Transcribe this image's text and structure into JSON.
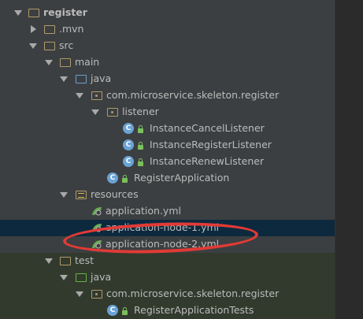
{
  "tree": {
    "root": "register",
    "mvn": ".mvn",
    "src": "src",
    "main": "main",
    "java": "java",
    "main_package": "com.microservice.skeleton.register",
    "listener": "listener",
    "listener_classes": [
      "InstanceCancelListener",
      "InstanceRegisterListener",
      "InstanceRenewListener"
    ],
    "register_app": "RegisterApplication",
    "resources": "resources",
    "yml_files": [
      "application.yml",
      "application-node-1.yml",
      "application-node-2.yml"
    ],
    "test": "test",
    "test_java": "java",
    "test_package": "com.microservice.skeleton.register",
    "test_class": "RegisterApplicationTests"
  },
  "icons": {
    "class_letter": "C"
  },
  "colors": {
    "background": "#3c3f41",
    "selected_row": "#0d293e",
    "annotation": "#e23a35"
  }
}
